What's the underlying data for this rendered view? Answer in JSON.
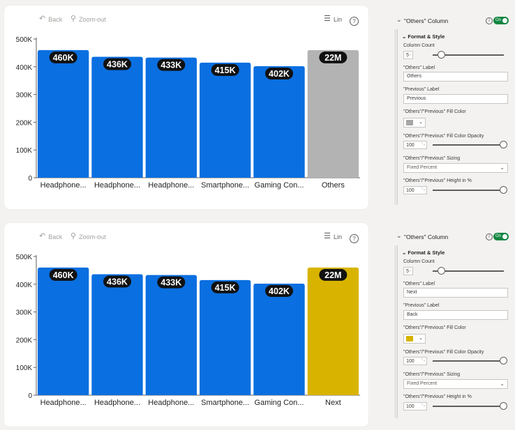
{
  "toolbar": {
    "back_label": "Back",
    "zoom_label": "Zoom-out",
    "lin_label": "Lin",
    "help_label": "?"
  },
  "chart_data": [
    {
      "type": "bar",
      "categories": [
        "Headphone...",
        "Headphone...",
        "Headphone...",
        "Smartphone...",
        "Gaming Con...",
        "Others"
      ],
      "values": [
        460000,
        436000,
        433000,
        415000,
        402000,
        460000
      ],
      "data_labels": [
        "460K",
        "436K",
        "433K",
        "415K",
        "402K",
        "22M"
      ],
      "bar_colors": [
        "#0a6fe0",
        "#0a6fe0",
        "#0a6fe0",
        "#0a6fe0",
        "#0a6fe0",
        "#b3b3b3"
      ],
      "ylim": [
        0,
        500000
      ],
      "yticks": [
        0,
        100000,
        200000,
        300000,
        400000,
        500000
      ],
      "ytick_labels": [
        "0",
        "100K",
        "200K",
        "300K",
        "400K",
        "500K"
      ],
      "grid": false,
      "title": "",
      "xlabel": "",
      "ylabel": ""
    },
    {
      "type": "bar",
      "categories": [
        "Headphone...",
        "Headphone...",
        "Headphone...",
        "Smartphone...",
        "Gaming Con...",
        "Next"
      ],
      "values": [
        460000,
        436000,
        433000,
        415000,
        402000,
        460000
      ],
      "data_labels": [
        "460K",
        "436K",
        "433K",
        "415K",
        "402K",
        "22M"
      ],
      "bar_colors": [
        "#0a6fe0",
        "#0a6fe0",
        "#0a6fe0",
        "#0a6fe0",
        "#0a6fe0",
        "#d8b400"
      ],
      "ylim": [
        0,
        500000
      ],
      "yticks": [
        0,
        100000,
        200000,
        300000,
        400000,
        500000
      ],
      "ytick_labels": [
        "0",
        "100K",
        "200K",
        "300K",
        "400K",
        "500K"
      ],
      "grid": false,
      "title": "",
      "xlabel": "",
      "ylabel": ""
    }
  ],
  "panels": [
    {
      "header": "\"Others\" Column",
      "toggle_label": "On",
      "section": "Format & Style",
      "column_count_label": "Column Count",
      "column_count": "5",
      "column_count_fraction": 0.05,
      "others_label_label": "\"Others\" Label",
      "others_label": "Others",
      "previous_label_label": "\"Previous\" Label",
      "previous_label": "Previous",
      "fill_color_label": "\"Others\"/\"Previous\" Fill Color",
      "fill_color": "#a6a6a6",
      "opacity_label": "\"Others\"/\"Previous\" Fill Color Opacity",
      "opacity": "100",
      "sizing_label": "\"Others\"/\"Previous\" Sizing",
      "sizing": "Fixed Percent",
      "height_label": "\"Others\"/\"Previous\" Height in %",
      "height": "100"
    },
    {
      "header": "\"Others\" Column",
      "toggle_label": "On",
      "section": "Format & Style",
      "column_count_label": "Column Count",
      "column_count": "5",
      "column_count_fraction": 0.05,
      "others_label_label": "\"Others\" Label",
      "others_label": "Next",
      "previous_label_label": "\"Previous\" Label",
      "previous_label": "Back",
      "fill_color_label": "\"Others\"/\"Previous\" Fill Color",
      "fill_color": "#d8b400",
      "opacity_label": "\"Others\"/\"Previous\" Fill Color Opacity",
      "opacity": "100",
      "sizing_label": "\"Others\"/\"Previous\" Sizing",
      "sizing": "Fixed Percent",
      "height_label": "\"Others\"/\"Previous\" Height in %",
      "height": "100"
    }
  ]
}
